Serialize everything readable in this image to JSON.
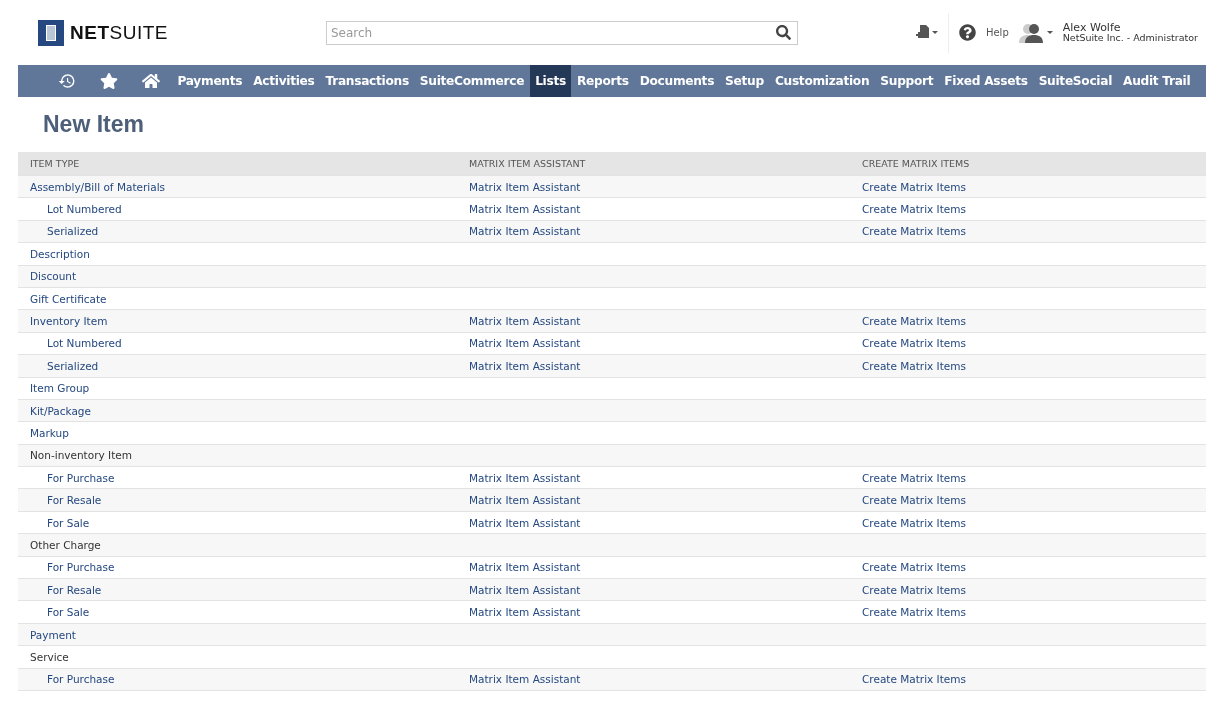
{
  "header": {
    "logo": "**NET**SUITE",
    "search": {
      "placeholder": "Search"
    },
    "help": "Help",
    "user": {
      "name": "Alex Wolfe",
      "role": "NetSuite Inc. - Administrator"
    }
  },
  "nav": {
    "items": [
      {
        "label": "Payments",
        "selected": false
      },
      {
        "label": "Activities",
        "selected": false
      },
      {
        "label": "Transactions",
        "selected": false
      },
      {
        "label": "SuiteCommerce",
        "selected": false
      },
      {
        "label": "Lists",
        "selected": true
      },
      {
        "label": "Reports",
        "selected": false
      },
      {
        "label": "Documents",
        "selected": false
      },
      {
        "label": "Setup",
        "selected": false
      },
      {
        "label": "Customization",
        "selected": false
      },
      {
        "label": "Support",
        "selected": false
      },
      {
        "label": "Fixed Assets",
        "selected": false
      },
      {
        "label": "SuiteSocial",
        "selected": false
      },
      {
        "label": "Audit Trail",
        "selected": false
      }
    ]
  },
  "page": {
    "title": "New Item"
  },
  "table": {
    "columns": [
      "ITEM TYPE",
      "MATRIX ITEM ASSISTANT",
      "CREATE MATRIX ITEMS"
    ],
    "rows": [
      {
        "item_type": "Assembly/Bill of Materials",
        "linked": true,
        "matrix": "Matrix Item Assistant",
        "create": "Create Matrix Items",
        "children": [
          {
            "item_type": "Lot Numbered",
            "linked": true,
            "matrix": "Matrix Item Assistant",
            "create": "Create Matrix Items"
          },
          {
            "item_type": "Serialized",
            "linked": true,
            "matrix": "Matrix Item Assistant",
            "create": "Create Matrix Items"
          }
        ]
      },
      {
        "item_type": "Description",
        "linked": true
      },
      {
        "item_type": "Discount",
        "linked": true
      },
      {
        "item_type": "Gift Certificate",
        "linked": true
      },
      {
        "item_type": "Inventory Item",
        "linked": true,
        "matrix": "Matrix Item Assistant",
        "create": "Create Matrix Items",
        "children": [
          {
            "item_type": "Lot Numbered",
            "linked": true,
            "matrix": "Matrix Item Assistant",
            "create": "Create Matrix Items"
          },
          {
            "item_type": "Serialized",
            "linked": true,
            "matrix": "Matrix Item Assistant",
            "create": "Create Matrix Items"
          }
        ]
      },
      {
        "item_type": "Item Group",
        "linked": true
      },
      {
        "item_type": "Kit/Package",
        "linked": true
      },
      {
        "item_type": "Markup",
        "linked": true
      },
      {
        "item_type": "Non-inventory Item",
        "linked": false,
        "children": [
          {
            "item_type": "For Purchase",
            "linked": true,
            "matrix": "Matrix Item Assistant",
            "create": "Create Matrix Items"
          },
          {
            "item_type": "For Resale",
            "linked": true,
            "matrix": "Matrix Item Assistant",
            "create": "Create Matrix Items"
          },
          {
            "item_type": "For Sale",
            "linked": true,
            "matrix": "Matrix Item Assistant",
            "create": "Create Matrix Items"
          }
        ]
      },
      {
        "item_type": "Other Charge",
        "linked": false,
        "children": [
          {
            "item_type": "For Purchase",
            "linked": true,
            "matrix": "Matrix Item Assistant",
            "create": "Create Matrix Items"
          },
          {
            "item_type": "For Resale",
            "linked": true,
            "matrix": "Matrix Item Assistant",
            "create": "Create Matrix Items"
          },
          {
            "item_type": "For Sale",
            "linked": true,
            "matrix": "Matrix Item Assistant",
            "create": "Create Matrix Items"
          }
        ]
      },
      {
        "item_type": "Payment",
        "linked": true
      },
      {
        "item_type": "Service",
        "linked": false,
        "children": [
          {
            "item_type": "For Purchase",
            "linked": true,
            "matrix": "Matrix Item Assistant",
            "create": "Create Matrix Items"
          }
        ]
      }
    ]
  }
}
